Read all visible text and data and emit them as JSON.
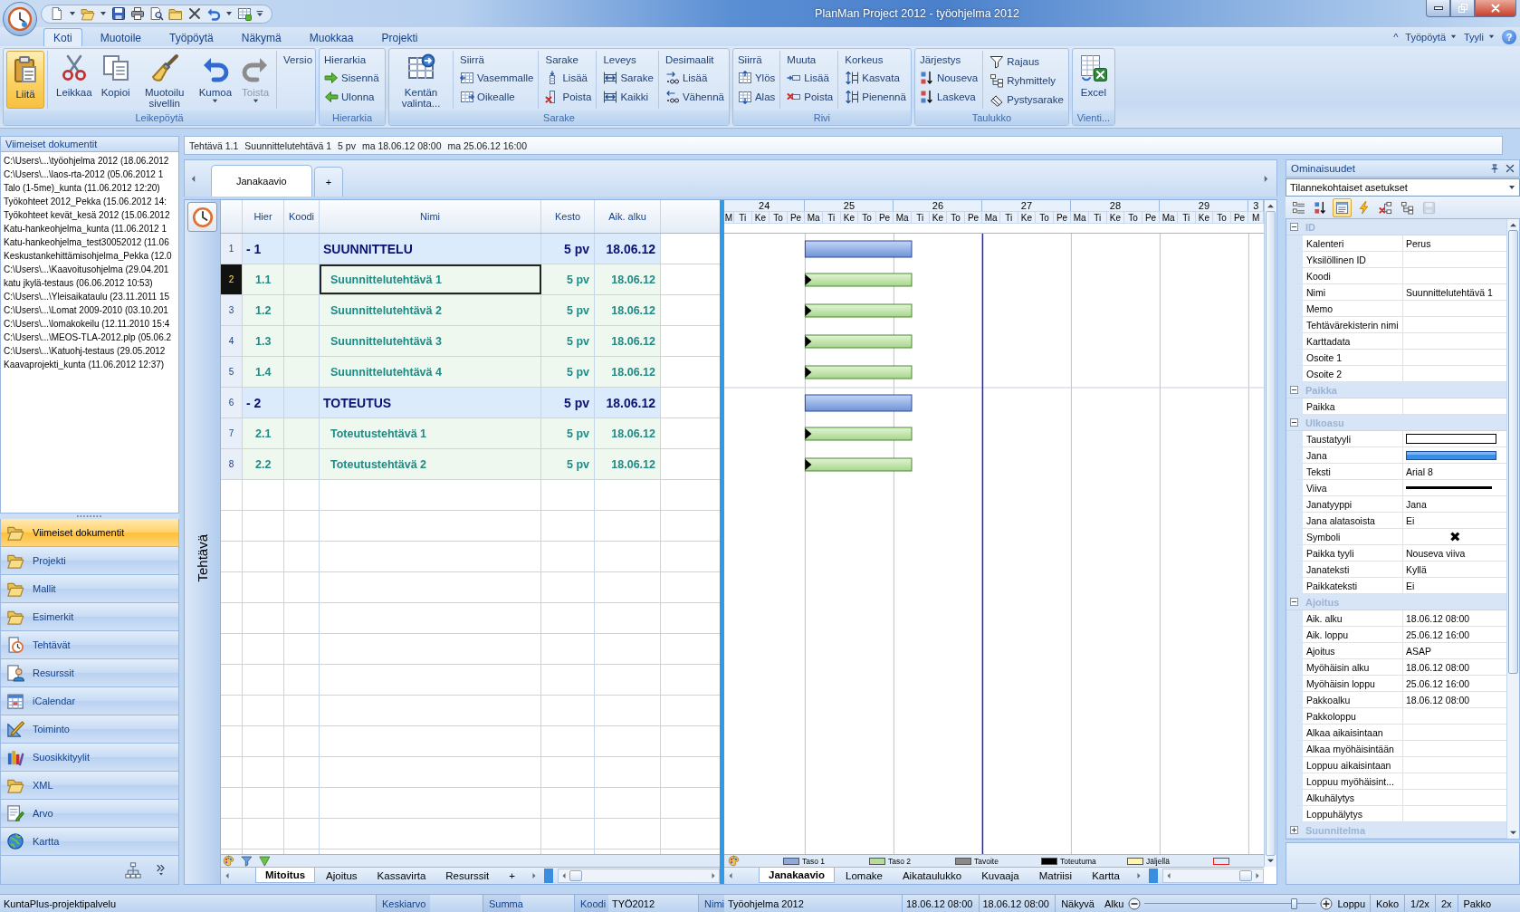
{
  "window": {
    "title": "PlanMan Project 2012 - työohjelma 2012"
  },
  "ribbon": {
    "tabs": [
      {
        "label": "Koti",
        "selected": true
      },
      {
        "label": "Muotoile",
        "selected": false
      },
      {
        "label": "Työpöytä",
        "selected": false
      },
      {
        "label": "Näkymä",
        "selected": false
      },
      {
        "label": "Muokkaa",
        "selected": false
      },
      {
        "label": "Projekti",
        "selected": false
      }
    ],
    "collapse_button": "^",
    "menus": [
      "Työpöytä",
      "Tyyli"
    ],
    "help": "?",
    "groups": [
      {
        "label": "Leikepöytä",
        "sections": [
          {
            "kind": "large",
            "items": [
              {
                "label": "Liitä",
                "highlighted": true
              }
            ]
          },
          {
            "kind": "large",
            "items": [
              {
                "label": "Leikkaa",
                "dropdown": false,
                "disabled": false
              },
              {
                "label": "Kopioi",
                "dropdown": false,
                "disabled": false
              },
              {
                "label": "Muotoilu sivellin",
                "dropdown": false,
                "disabled": false
              },
              {
                "label": "Kumoa",
                "dropdown": true,
                "disabled": false
              },
              {
                "label": "Toista",
                "dropdown": true,
                "disabled": true
              }
            ]
          },
          {
            "kind": "stack",
            "heading": "Versio"
          }
        ]
      },
      {
        "label": "Hierarkia",
        "sections": [
          {
            "kind": "stack",
            "heading": "Hierarkia",
            "items": [
              {
                "label": "Sisennä"
              },
              {
                "label": "Ulonna"
              }
            ]
          }
        ]
      },
      {
        "label": "Sarake",
        "sections": [
          {
            "kind": "large",
            "items": [
              {
                "label": "Kentän valinta..."
              }
            ]
          },
          {
            "kind": "stack",
            "heading": "Siirrä",
            "items": [
              {
                "label": "Vasemmalle"
              },
              {
                "label": "Oikealle"
              }
            ]
          },
          {
            "kind": "stack",
            "heading": "Sarake",
            "items": [
              {
                "label": "Lisää"
              },
              {
                "label": "Poista"
              }
            ]
          },
          {
            "kind": "stack",
            "heading": "Leveys",
            "items": [
              {
                "label": "Sarake"
              },
              {
                "label": "Kaikki"
              }
            ]
          },
          {
            "kind": "stack",
            "heading": "Desimaalit",
            "items": [
              {
                "label": "Lisää"
              },
              {
                "label": "Vähennä"
              }
            ]
          }
        ]
      },
      {
        "label": "Rivi",
        "sections": [
          {
            "kind": "stack",
            "heading": "Siirrä",
            "items": [
              {
                "label": "Ylös"
              },
              {
                "label": "Alas"
              }
            ]
          },
          {
            "kind": "stack",
            "heading": "Muuta",
            "items": [
              {
                "label": "Lisää"
              },
              {
                "label": "Poista"
              }
            ]
          },
          {
            "kind": "stack",
            "heading": "Korkeus",
            "items": [
              {
                "label": "Kasvata"
              },
              {
                "label": "Pienennä"
              }
            ]
          }
        ]
      },
      {
        "label": "Taulukko",
        "sections": [
          {
            "kind": "stack",
            "heading": "Järjestys",
            "items": [
              {
                "label": "Nouseva"
              },
              {
                "label": "Laskeva"
              }
            ]
          },
          {
            "kind": "stack",
            "items": [
              {
                "label": "Rajaus"
              },
              {
                "label": "Ryhmittely"
              },
              {
                "label": "Pystysarake"
              }
            ]
          }
        ]
      },
      {
        "label": "Vienti...",
        "sections": [
          {
            "kind": "large",
            "items": [
              {
                "label": "Excel"
              }
            ]
          }
        ]
      }
    ]
  },
  "recent": {
    "title": "Viimeiset dokumentit",
    "items": [
      "C:\\Users\\...\\työohjelma 2012 (18.06.2012",
      "C:\\Users\\...\\laos-rta-2012 (05.06.2012 1",
      "Talo (1-5me)_kunta (11.06.2012 12:20)",
      "Työkohteet 2012_Pekka (15.06.2012 14:",
      "Työkohteet kevät_kesä 2012 (15.06.2012",
      "Katu-hankeohjelma_kunta (11.06.2012 1",
      "Katu-hankeohjelma_test30052012 (11.06",
      "Keskustankehittämisohjelma_Pekka (12.0",
      "C:\\Users\\...\\Kaavoitusohjelma (29.04.201",
      "katu jkylä-testaus (06.06.2012 10:53)",
      "C:\\Users\\...\\Yleisaikataulu (23.11.2011 15",
      "C:\\Users\\...\\Lomat 2009-2010 (03.10.201",
      "C:\\Users\\...\\lomakokeilu (12.11.2010 15:4",
      "C:\\Users\\...\\MEOS-TLA-2012.plp (05.06.2",
      "C:\\Users\\...\\Katuohj-testaus (29.05.2012",
      "Kaavaprojekti_kunta (11.06.2012 12:37)"
    ]
  },
  "navigator": [
    {
      "label": "Viimeiset dokumentit",
      "selected": true
    },
    {
      "label": "Projekti",
      "selected": false
    },
    {
      "label": "Mallit",
      "selected": false
    },
    {
      "label": "Esimerkit",
      "selected": false
    },
    {
      "label": "Tehtävät",
      "selected": false
    },
    {
      "label": "Resurssit",
      "selected": false
    },
    {
      "label": "iCalendar",
      "selected": false
    },
    {
      "label": "Toiminto",
      "selected": false
    },
    {
      "label": "Suosikkityylit",
      "selected": false
    },
    {
      "label": "XML",
      "selected": false
    },
    {
      "label": "Arvo",
      "selected": false
    },
    {
      "label": "Kartta",
      "selected": false
    }
  ],
  "task_info": [
    "Tehtävä 1.1",
    "Suunnittelutehtävä 1",
    "5 pv",
    "ma 18.06.12 08:00",
    "ma 25.06.12 16:00"
  ],
  "view_tabs": [
    {
      "label": "Janakaavio",
      "selected": true
    },
    {
      "label": "+",
      "selected": false
    }
  ],
  "side_label": "Tehtävä",
  "table": {
    "columns": [
      "Hier",
      "Koodi",
      "Nimi",
      "Kesto",
      "Aik. alku"
    ],
    "rows": [
      {
        "number": "1",
        "kind": "summary",
        "hier": "- 1",
        "name": "SUUNNITTELU",
        "duration": "5 pv",
        "start": "18.06.12",
        "selected": false
      },
      {
        "number": "2",
        "kind": "task",
        "hier": "1.1",
        "name": "Suunnittelutehtävä 1",
        "duration": "5 pv",
        "start": "18.06.12",
        "selected": true
      },
      {
        "number": "3",
        "kind": "task",
        "hier": "1.2",
        "name": "Suunnittelutehtävä 2",
        "duration": "5 pv",
        "start": "18.06.12",
        "selected": false
      },
      {
        "number": "4",
        "kind": "task",
        "hier": "1.3",
        "name": "Suunnittelutehtävä 3",
        "duration": "5 pv",
        "start": "18.06.12",
        "selected": false
      },
      {
        "number": "5",
        "kind": "task",
        "hier": "1.4",
        "name": "Suunnittelutehtävä 4",
        "duration": "5 pv",
        "start": "18.06.12",
        "selected": false
      },
      {
        "number": "6",
        "kind": "summary",
        "hier": "- 2",
        "name": "TOTEUTUS",
        "duration": "5 pv",
        "start": "18.06.12",
        "selected": false
      },
      {
        "number": "7",
        "kind": "task",
        "hier": "2.1",
        "name": "Toteutustehtävä 1",
        "duration": "5 pv",
        "start": "18.06.12",
        "selected": false
      },
      {
        "number": "8",
        "kind": "task",
        "hier": "2.2",
        "name": "Toteutustehtävä 2",
        "duration": "5 pv",
        "start": "18.06.12",
        "selected": false
      }
    ],
    "tabs": [
      {
        "label": "Mitoitus",
        "selected": true
      },
      {
        "label": "Ajoitus",
        "selected": false
      },
      {
        "label": "Kassavirta",
        "selected": false
      },
      {
        "label": "Resurssit",
        "selected": false
      },
      {
        "label": "+",
        "selected": false
      }
    ]
  },
  "gantt": {
    "weeks": [
      {
        "label": "24",
        "days": [
          "M",
          "Ti",
          "Ke",
          "To",
          "Pe"
        ]
      },
      {
        "label": "25",
        "days": [
          "Ma",
          "Ti",
          "Ke",
          "To",
          "Pe"
        ]
      },
      {
        "label": "26",
        "days": [
          "Ma",
          "Ti",
          "Ke",
          "To",
          "Pe"
        ]
      },
      {
        "label": "27",
        "days": [
          "Ma",
          "Ti",
          "Ke",
          "To",
          "Pe"
        ]
      },
      {
        "label": "28",
        "days": [
          "Ma",
          "Ti",
          "Ke",
          "To",
          "Pe"
        ]
      },
      {
        "label": "29",
        "days": [
          "Ma",
          "Ti",
          "Ke",
          "To",
          "Pe"
        ]
      },
      {
        "label": "3",
        "days": [
          "M"
        ]
      }
    ],
    "legend": [
      {
        "kind": "fill",
        "label": "Taso 1",
        "color": "#8ea9e0"
      },
      {
        "kind": "fill",
        "label": "Taso 2",
        "color": "#b6dc9c"
      },
      {
        "kind": "fill",
        "label": "Tavoite",
        "color": "#8a8a8a"
      },
      {
        "kind": "fill",
        "label": "Toteutuma",
        "color": "#000000"
      },
      {
        "kind": "fill",
        "label": "Jäljellä",
        "color": "#fff5b0"
      },
      {
        "kind": "outline",
        "color": "#e02020"
      }
    ],
    "tabs": [
      {
        "label": "Janakaavio",
        "selected": true
      },
      {
        "label": "Lomake",
        "selected": false
      },
      {
        "label": "Aikataulukko",
        "selected": false
      },
      {
        "label": "Kuvaaja",
        "selected": false
      },
      {
        "label": "Matriisi",
        "selected": false
      },
      {
        "label": "Kartta",
        "selected": false
      }
    ]
  },
  "properties": {
    "title": "Ominaisuudet",
    "scope": "Tilannekohtaiset asetukset",
    "toolbar": [
      {
        "selected": false,
        "disabled": false
      },
      {
        "selected": false,
        "disabled": false
      },
      {
        "selected": true,
        "disabled": false
      },
      {
        "selected": false,
        "disabled": false
      },
      {
        "selected": false,
        "disabled": false
      },
      {
        "selected": false,
        "disabled": false
      },
      {
        "selected": false,
        "disabled": true
      }
    ],
    "categories": [
      {
        "label": "ID",
        "expanded": true,
        "rows": [
          {
            "kind": "text",
            "name": "Kalenteri",
            "value": "Perus"
          },
          {
            "kind": "text",
            "name": "Yksilöllinen ID"
          },
          {
            "kind": "text",
            "name": "Koodi"
          },
          {
            "kind": "text",
            "name": "Nimi",
            "value": "Suunnittelutehtävä 1"
          },
          {
            "kind": "text",
            "name": "Memo"
          },
          {
            "kind": "text",
            "name": "Tehtävärekisterin nimi"
          },
          {
            "kind": "text",
            "name": "Karttadata"
          },
          {
            "kind": "text",
            "name": "Osoite 1"
          },
          {
            "kind": "text",
            "name": "Osoite 2"
          }
        ]
      },
      {
        "label": "Paikka",
        "expanded": true,
        "rows": [
          {
            "kind": "text",
            "name": "Paikka"
          }
        ]
      },
      {
        "label": "Ulkoasu",
        "expanded": true,
        "rows": [
          {
            "kind": "fill",
            "name": "Taustatyyli",
            "color": "#ffffff"
          },
          {
            "kind": "bar",
            "name": "Jana",
            "color": "#3a8ee6"
          },
          {
            "kind": "text",
            "name": "Teksti",
            "value": "Arial 8"
          },
          {
            "kind": "line",
            "name": "Viiva",
            "color": "#000000"
          },
          {
            "kind": "text",
            "name": "Janatyyppi",
            "value": "Jana"
          },
          {
            "kind": "text",
            "name": "Jana alatasoista",
            "value": "Ei"
          },
          {
            "kind": "symbol",
            "name": "Symboli",
            "value": "✖"
          },
          {
            "kind": "text",
            "name": "Paikka tyyli",
            "value": "Nouseva viiva"
          },
          {
            "kind": "text",
            "name": "Janateksti",
            "value": "Kyllä"
          },
          {
            "kind": "text",
            "name": "Paikkateksti",
            "value": "Ei"
          }
        ]
      },
      {
        "label": "Ajoitus",
        "expanded": true,
        "rows": [
          {
            "kind": "text",
            "name": "Aik. alku",
            "value": "18.06.12 08:00"
          },
          {
            "kind": "text",
            "name": "Aik. loppu",
            "value": "25.06.12 16:00"
          },
          {
            "kind": "text",
            "name": "Ajoitus",
            "value": "ASAP"
          },
          {
            "kind": "text",
            "name": "Myöhäisin alku",
            "value": "18.06.12 08:00"
          },
          {
            "kind": "text",
            "name": "Myöhäisin loppu",
            "value": "25.06.12 16:00"
          },
          {
            "kind": "text",
            "name": "Pakkoalku",
            "value": "18.06.12 08:00"
          },
          {
            "kind": "text",
            "name": "Pakkoloppu"
          },
          {
            "kind": "text",
            "name": "Alkaa aikaisintaan"
          },
          {
            "kind": "text",
            "name": "Alkaa myöhäisintään"
          },
          {
            "kind": "text",
            "name": "Loppuu aikaisintaan"
          },
          {
            "kind": "text",
            "name": "Loppuu myöhäisint..."
          },
          {
            "kind": "text",
            "name": "Alkuhälytys"
          },
          {
            "kind": "text",
            "name": "Loppuhälytys"
          }
        ]
      },
      {
        "label": "Suunnitelma",
        "expanded": false
      }
    ]
  },
  "status_bar": {
    "service": "KuntaPlus-projektipalvelu",
    "fields": [
      {
        "label": "Keskiarvo"
      },
      {
        "label": "Summa"
      },
      {
        "label": "Koodi",
        "value": "TYÖ2012"
      },
      {
        "label": "Nimi",
        "value": "Työohjelma 2012"
      }
    ],
    "dates": [
      "18.06.12 08:00",
      "18.06.12 08:00"
    ],
    "visibility": "Näkyvä",
    "zoom": {
      "start": "Alku",
      "end": "Loppu",
      "level": 0.87
    },
    "buttons": [
      "Koko",
      "1/2x",
      "2x",
      "Pakko"
    ]
  }
}
